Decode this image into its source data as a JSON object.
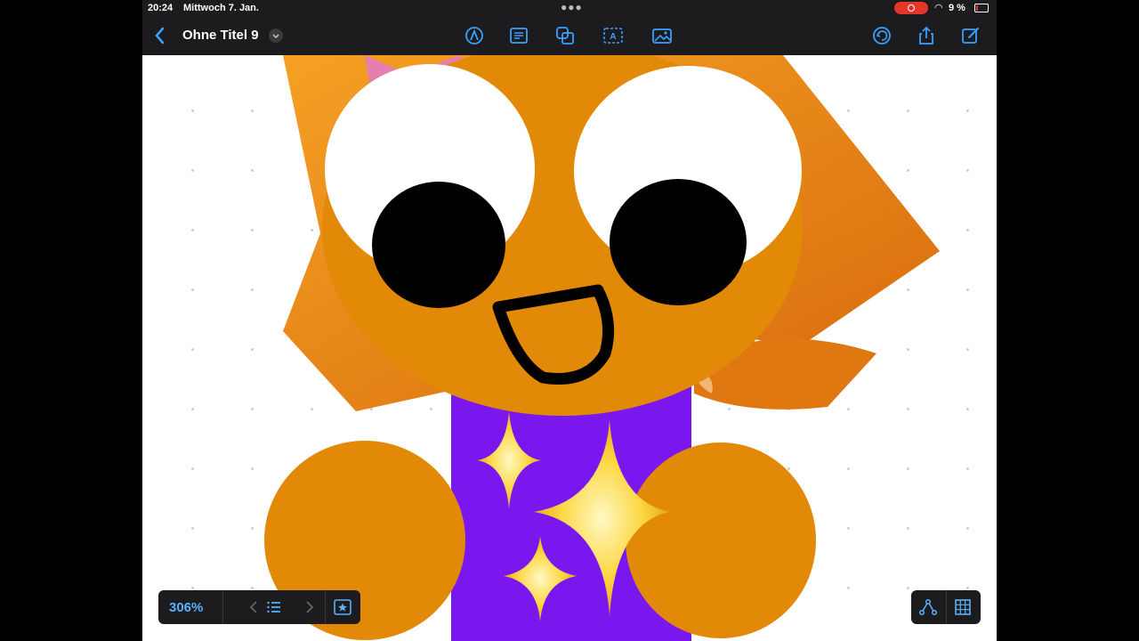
{
  "status": {
    "time": "20:24",
    "date": "Mittwoch 7. Jan.",
    "battery": "9 %"
  },
  "toolbar": {
    "title": "Ohne Titel 9"
  },
  "zoom": {
    "level": "306%"
  },
  "colors": {
    "accent": "#3aa0ff",
    "body": "#7a16ee",
    "face": "#e28a07",
    "hair": "#e07812"
  }
}
